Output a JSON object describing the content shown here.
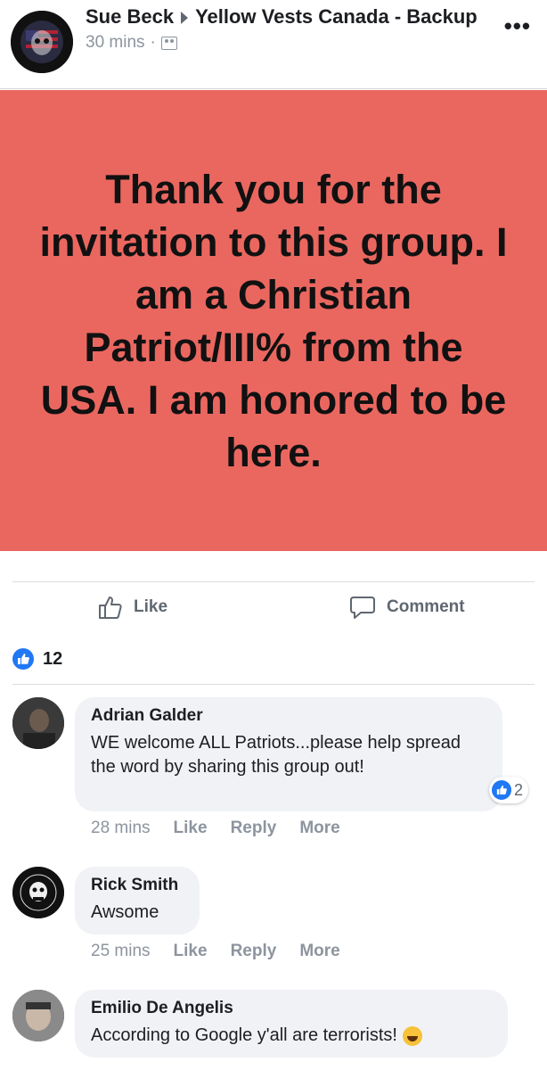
{
  "post": {
    "author": "Sue Beck",
    "group": "Yellow Vests Canada - Backup",
    "time": "30 mins",
    "dot": "·",
    "more": "•••",
    "icon_audience": "group-icon",
    "banner_text": "Thank you for the invitation to this group. I am a Christian Patriot/III% from the USA. I am honored to be here.",
    "banner_color": "#ea6760"
  },
  "actions": {
    "like_label": "Like",
    "comment_label": "Comment"
  },
  "reactions": {
    "count": "12"
  },
  "comments": [
    {
      "name": "Adrian Galder",
      "text": "WE welcome ALL Patriots...please help spread the word by sharing this group out!",
      "time": "28 mins",
      "like": "Like",
      "reply": "Reply",
      "more": "More",
      "reaction_count": "2"
    },
    {
      "name": "Rick Smith",
      "text": "Awsome",
      "time": "25 mins",
      "like": "Like",
      "reply": "Reply",
      "more": "More"
    },
    {
      "name": "Emilio De Angelis",
      "text": "According to Google y'all are terrorists!",
      "emoji": "laughing-emoji"
    }
  ],
  "colors": {
    "accent": "#2078f4",
    "muted": "#8d949e"
  }
}
